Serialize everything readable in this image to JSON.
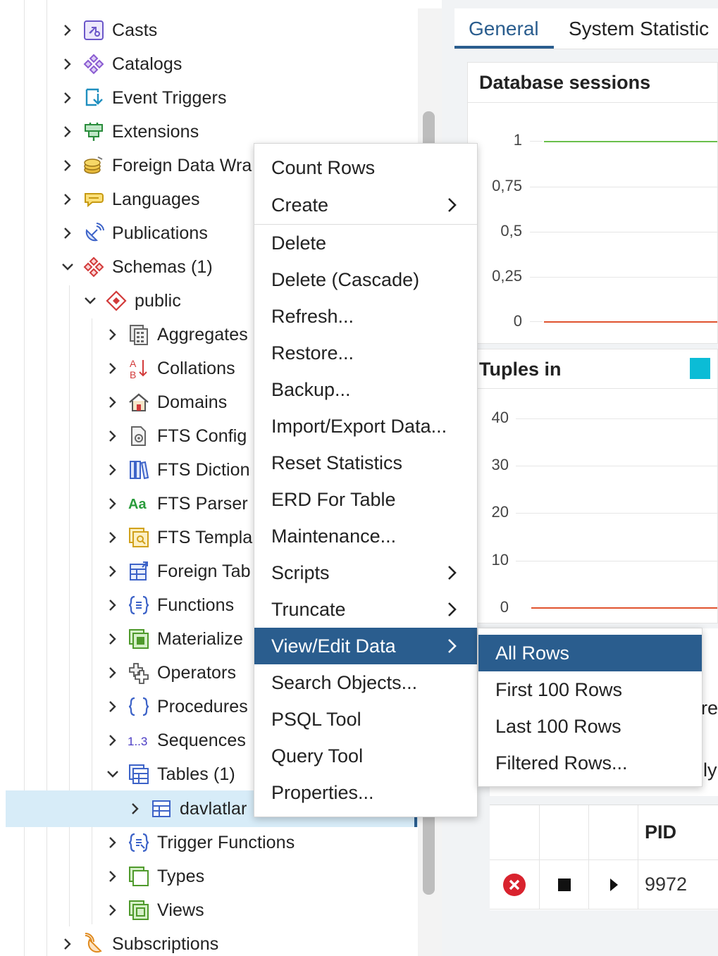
{
  "tree": {
    "items": [
      {
        "label": "Casts",
        "icon": "casts-icon",
        "expanded": false
      },
      {
        "label": "Catalogs",
        "icon": "catalogs-icon",
        "expanded": false
      },
      {
        "label": "Event Triggers",
        "icon": "event-triggers-icon",
        "expanded": false
      },
      {
        "label": "Extensions",
        "icon": "extensions-icon",
        "expanded": false
      },
      {
        "label": "Foreign Data Wra",
        "icon": "foreign-data-wrappers-icon",
        "expanded": false
      },
      {
        "label": "Languages",
        "icon": "languages-icon",
        "expanded": false
      },
      {
        "label": "Publications",
        "icon": "publications-icon",
        "expanded": false
      },
      {
        "label": "Schemas (1)",
        "icon": "schemas-icon",
        "expanded": true
      },
      {
        "label": "public",
        "icon": "schema-icon",
        "expanded": true
      },
      {
        "label": "Aggregates",
        "icon": "aggregates-icon",
        "expanded": false
      },
      {
        "label": "Collations",
        "icon": "collations-icon",
        "expanded": false
      },
      {
        "label": "Domains",
        "icon": "domains-icon",
        "expanded": false
      },
      {
        "label": "FTS Config",
        "icon": "fts-config-icon",
        "expanded": false
      },
      {
        "label": "FTS Diction",
        "icon": "fts-dictionaries-icon",
        "expanded": false
      },
      {
        "label": "FTS Parser",
        "icon": "fts-parsers-icon",
        "expanded": false
      },
      {
        "label": "FTS Templa",
        "icon": "fts-templates-icon",
        "expanded": false
      },
      {
        "label": "Foreign Tab",
        "icon": "foreign-tables-icon",
        "expanded": false
      },
      {
        "label": "Functions",
        "icon": "functions-icon",
        "expanded": false
      },
      {
        "label": "Materialize",
        "icon": "materialized-views-icon",
        "expanded": false
      },
      {
        "label": "Operators",
        "icon": "operators-icon",
        "expanded": false
      },
      {
        "label": "Procedures",
        "icon": "procedures-icon",
        "expanded": false
      },
      {
        "label": "Sequences",
        "icon": "sequences-icon",
        "expanded": false
      },
      {
        "label": "Tables (1)",
        "icon": "tables-icon",
        "expanded": true
      },
      {
        "label": "davlatlar",
        "icon": "table-icon",
        "expanded": false
      },
      {
        "label": "Trigger Functions",
        "icon": "trigger-functions-icon",
        "expanded": false
      },
      {
        "label": "Types",
        "icon": "types-icon",
        "expanded": false
      },
      {
        "label": "Views",
        "icon": "views-icon",
        "expanded": false
      },
      {
        "label": "Subscriptions",
        "icon": "subscriptions-icon",
        "expanded": false
      }
    ]
  },
  "tabs": {
    "general": "General",
    "stats": "System Statistic"
  },
  "sessions_card": {
    "title": "Database sessions",
    "ticks": [
      "1",
      "0,75",
      "0,5",
      "0,25",
      "0"
    ]
  },
  "tuples_card": {
    "title": "Tuples in",
    "ticks": [
      "40",
      "30",
      "20",
      "10",
      "0"
    ]
  },
  "partial_labels": {
    "a": "re",
    "b": "ly"
  },
  "proc_table": {
    "header_pid": "PID",
    "row_pid": "9972"
  },
  "menu": {
    "items": [
      {
        "label": "Count Rows",
        "submenu": false
      },
      {
        "label": "Create",
        "submenu": true
      },
      {
        "label": "Delete",
        "submenu": false
      },
      {
        "label": "Delete (Cascade)",
        "submenu": false
      },
      {
        "label": "Refresh...",
        "submenu": false
      },
      {
        "label": "Restore...",
        "submenu": false
      },
      {
        "label": "Backup...",
        "submenu": false
      },
      {
        "label": "Import/Export Data...",
        "submenu": false
      },
      {
        "label": "Reset Statistics",
        "submenu": false
      },
      {
        "label": "ERD For Table",
        "submenu": false
      },
      {
        "label": "Maintenance...",
        "submenu": false
      },
      {
        "label": "Scripts",
        "submenu": true
      },
      {
        "label": "Truncate",
        "submenu": true
      },
      {
        "label": "View/Edit Data",
        "submenu": true
      },
      {
        "label": "Search Objects...",
        "submenu": false
      },
      {
        "label": "PSQL Tool",
        "submenu": false
      },
      {
        "label": "Query Tool",
        "submenu": false
      },
      {
        "label": "Properties...",
        "submenu": false
      }
    ]
  },
  "submenu": {
    "items": [
      {
        "label": "All Rows"
      },
      {
        "label": "First 100 Rows"
      },
      {
        "label": "Last 100 Rows"
      },
      {
        "label": "Filtered Rows..."
      }
    ]
  },
  "colors": {
    "accent": "#2a5d8e",
    "selection": "#d7ecf8",
    "line_green": "#6abf4b",
    "line_red": "#e0532f",
    "legend_cyan": "#0bbcd6",
    "cancel_red": "#d9232e"
  }
}
